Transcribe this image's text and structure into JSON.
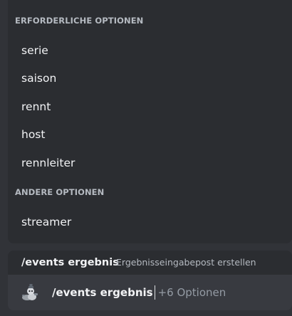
{
  "popup": {
    "required_header": "ERFORDERLICHE OPTIONEN",
    "required_options": [
      "serie",
      "saison",
      "rennt",
      "host",
      "rennleiter"
    ],
    "other_header": "ANDERE OPTIONEN",
    "other_options": [
      "streamer"
    ]
  },
  "command": {
    "name": "/events ergebnis",
    "description": "Ergebnisseingabepost erstellen"
  },
  "input": {
    "value": "/events ergebnis",
    "hint": "+6 Optionen",
    "app_icon": "bot-avatar-icon"
  },
  "colors": {
    "background": "#313338",
    "popup_background": "#2b2d31",
    "input_background": "#383a40",
    "header_text": "#b5bac1",
    "option_text": "#f2f3f5",
    "hint_text": "#949ba4"
  }
}
